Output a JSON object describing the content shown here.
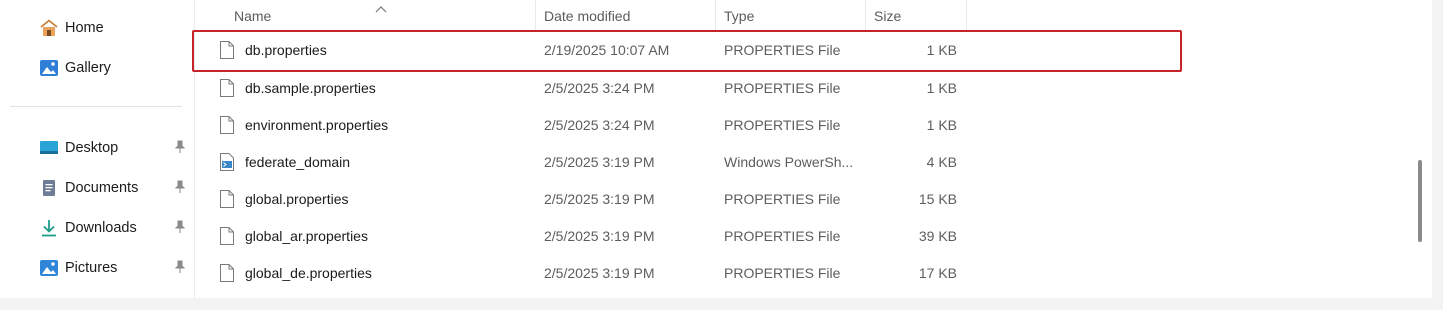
{
  "sidebar": {
    "items": [
      {
        "label": "Home",
        "icon": "home-icon",
        "pinned": false
      },
      {
        "label": "Gallery",
        "icon": "gallery-icon",
        "pinned": false
      },
      {
        "label": "Desktop",
        "icon": "desktop-icon",
        "pinned": true
      },
      {
        "label": "Documents",
        "icon": "documents-icon",
        "pinned": true
      },
      {
        "label": "Downloads",
        "icon": "downloads-icon",
        "pinned": true
      },
      {
        "label": "Pictures",
        "icon": "pictures-icon",
        "pinned": true
      }
    ]
  },
  "columns": {
    "name": "Name",
    "date": "Date modified",
    "type": "Type",
    "size": "Size"
  },
  "files": [
    {
      "name": "db.properties",
      "date": "2/19/2025 10:07 AM",
      "type": "PROPERTIES File",
      "size": "1 KB",
      "icon": "file-icon",
      "selected_highlight": true
    },
    {
      "name": "db.sample.properties",
      "date": "2/5/2025 3:24 PM",
      "type": "PROPERTIES File",
      "size": "1 KB",
      "icon": "file-icon"
    },
    {
      "name": "environment.properties",
      "date": "2/5/2025 3:24 PM",
      "type": "PROPERTIES File",
      "size": "1 KB",
      "icon": "file-icon"
    },
    {
      "name": "federate_domain",
      "date": "2/5/2025 3:19 PM",
      "type": "Windows PowerSh...",
      "size": "4 KB",
      "icon": "powershell-file-icon"
    },
    {
      "name": "global.properties",
      "date": "2/5/2025 3:19 PM",
      "type": "PROPERTIES File",
      "size": "15 KB",
      "icon": "file-icon"
    },
    {
      "name": "global_ar.properties",
      "date": "2/5/2025 3:19 PM",
      "type": "PROPERTIES File",
      "size": "39 KB",
      "icon": "file-icon"
    },
    {
      "name": "global_de.properties",
      "date": "2/5/2025 3:19 PM",
      "type": "PROPERTIES File",
      "size": "17 KB",
      "icon": "file-icon"
    }
  ],
  "colors": {
    "highlight_border": "#c7232b",
    "text_primary": "#1b1b1b",
    "text_secondary": "#5d5d5d"
  }
}
